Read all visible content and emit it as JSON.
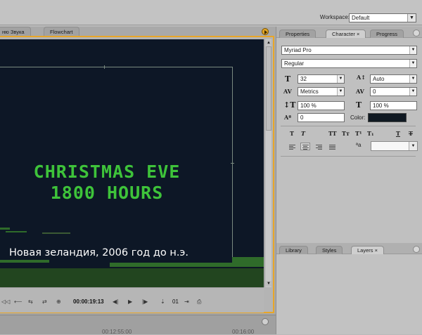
{
  "workspace": {
    "label": "Workspace:",
    "value": "Default"
  },
  "left_tabs": [
    {
      "label": "ню Звука",
      "active": false
    },
    {
      "label": "Flowchart",
      "active": false
    }
  ],
  "video": {
    "title_line1": "CHRISTMAS EVE",
    "title_line2": "1800 HOURS",
    "subtitle": "Новая зеландия, 2006 год до н.э.",
    "title_color": "#3ec33a",
    "background_color": "#0d1726"
  },
  "transport": {
    "timecode": "00:00:19:13",
    "frame_count": "01",
    "buttons": [
      "step-back-icon",
      "play-icon",
      "step-forward-icon",
      "mark-in-icon",
      "mark-out-icon",
      "export-frame-icon"
    ]
  },
  "bottom_strip": {
    "time1": "00:12:55:00",
    "time2": "00:16:00"
  },
  "character_panel": {
    "tabs": [
      {
        "label": "Properties",
        "active": false
      },
      {
        "label": "Character",
        "active": true,
        "close": "×"
      },
      {
        "label": "Progress",
        "active": false
      }
    ],
    "font_family": "Myriad Pro",
    "font_style": "Regular",
    "font_size": "32",
    "leading": "Auto",
    "kerning": "Metrics",
    "tracking": "0",
    "vertical_scale": "100 %",
    "horizontal_scale": "100 %",
    "baseline_shift": "0",
    "color_label": "Color:",
    "color_value": "#101922",
    "style_buttons": [
      "T",
      "T",
      "TT",
      "Tт",
      "T¹",
      "T₁",
      "T",
      "T"
    ],
    "anti_alias_label": "ªa"
  },
  "layers_panel": {
    "tabs": [
      {
        "label": "Library",
        "active": false
      },
      {
        "label": "Styles",
        "active": false
      },
      {
        "label": "Layers",
        "active": true,
        "close": "×"
      }
    ]
  }
}
